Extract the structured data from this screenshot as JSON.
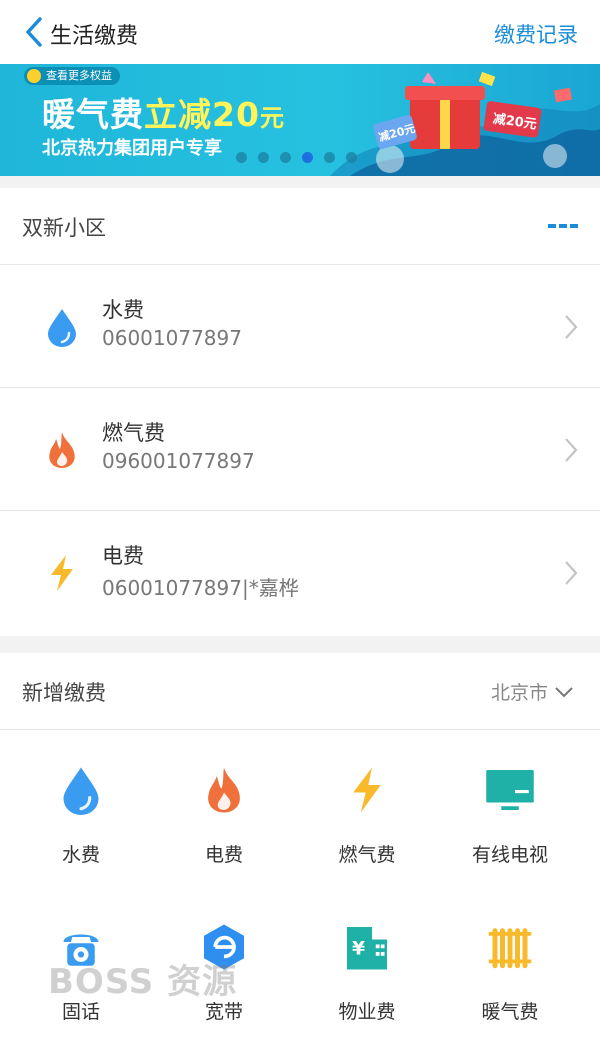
{
  "nav": {
    "title": "生活缴费",
    "record": "缴费记录"
  },
  "banner": {
    "tag": "查看更多权益",
    "headline_a": "暖气费",
    "headline_b": "立减20",
    "headline_c": "元",
    "subline": "北京热力集团用户专享",
    "coupon_a": "减20元",
    "coupon_b": "减20元",
    "slide_count": 6,
    "active_slide": 4
  },
  "community": {
    "name": "双新小区",
    "items": [
      {
        "name": "水费",
        "account": "06001077897",
        "icon": "water-drop-icon"
      },
      {
        "name": "燃气费",
        "account": "096001077897",
        "icon": "flame-icon"
      },
      {
        "name": "电费",
        "account": "06001077897|*嘉桦",
        "icon": "lightning-icon"
      }
    ]
  },
  "add": {
    "title": "新增缴费",
    "city": "北京市",
    "items": [
      {
        "label": "水费",
        "icon": "water-drop-icon"
      },
      {
        "label": "电费",
        "icon": "flame-icon"
      },
      {
        "label": "燃气费",
        "icon": "lightning-icon"
      },
      {
        "label": "有线电视",
        "icon": "tv-icon"
      },
      {
        "label": "固话",
        "icon": "telephone-icon"
      },
      {
        "label": "宽带",
        "icon": "broadband-icon"
      },
      {
        "label": "物业费",
        "icon": "building-icon"
      },
      {
        "label": "暖气费",
        "icon": "radiator-icon"
      }
    ]
  },
  "watermark": "BOSS 资源",
  "colors": {
    "accent": "#1a8cd8",
    "water": "#3a9cf0",
    "flame": "#f0703c",
    "bolt": "#f8b92a",
    "teal": "#1fb0a8"
  }
}
